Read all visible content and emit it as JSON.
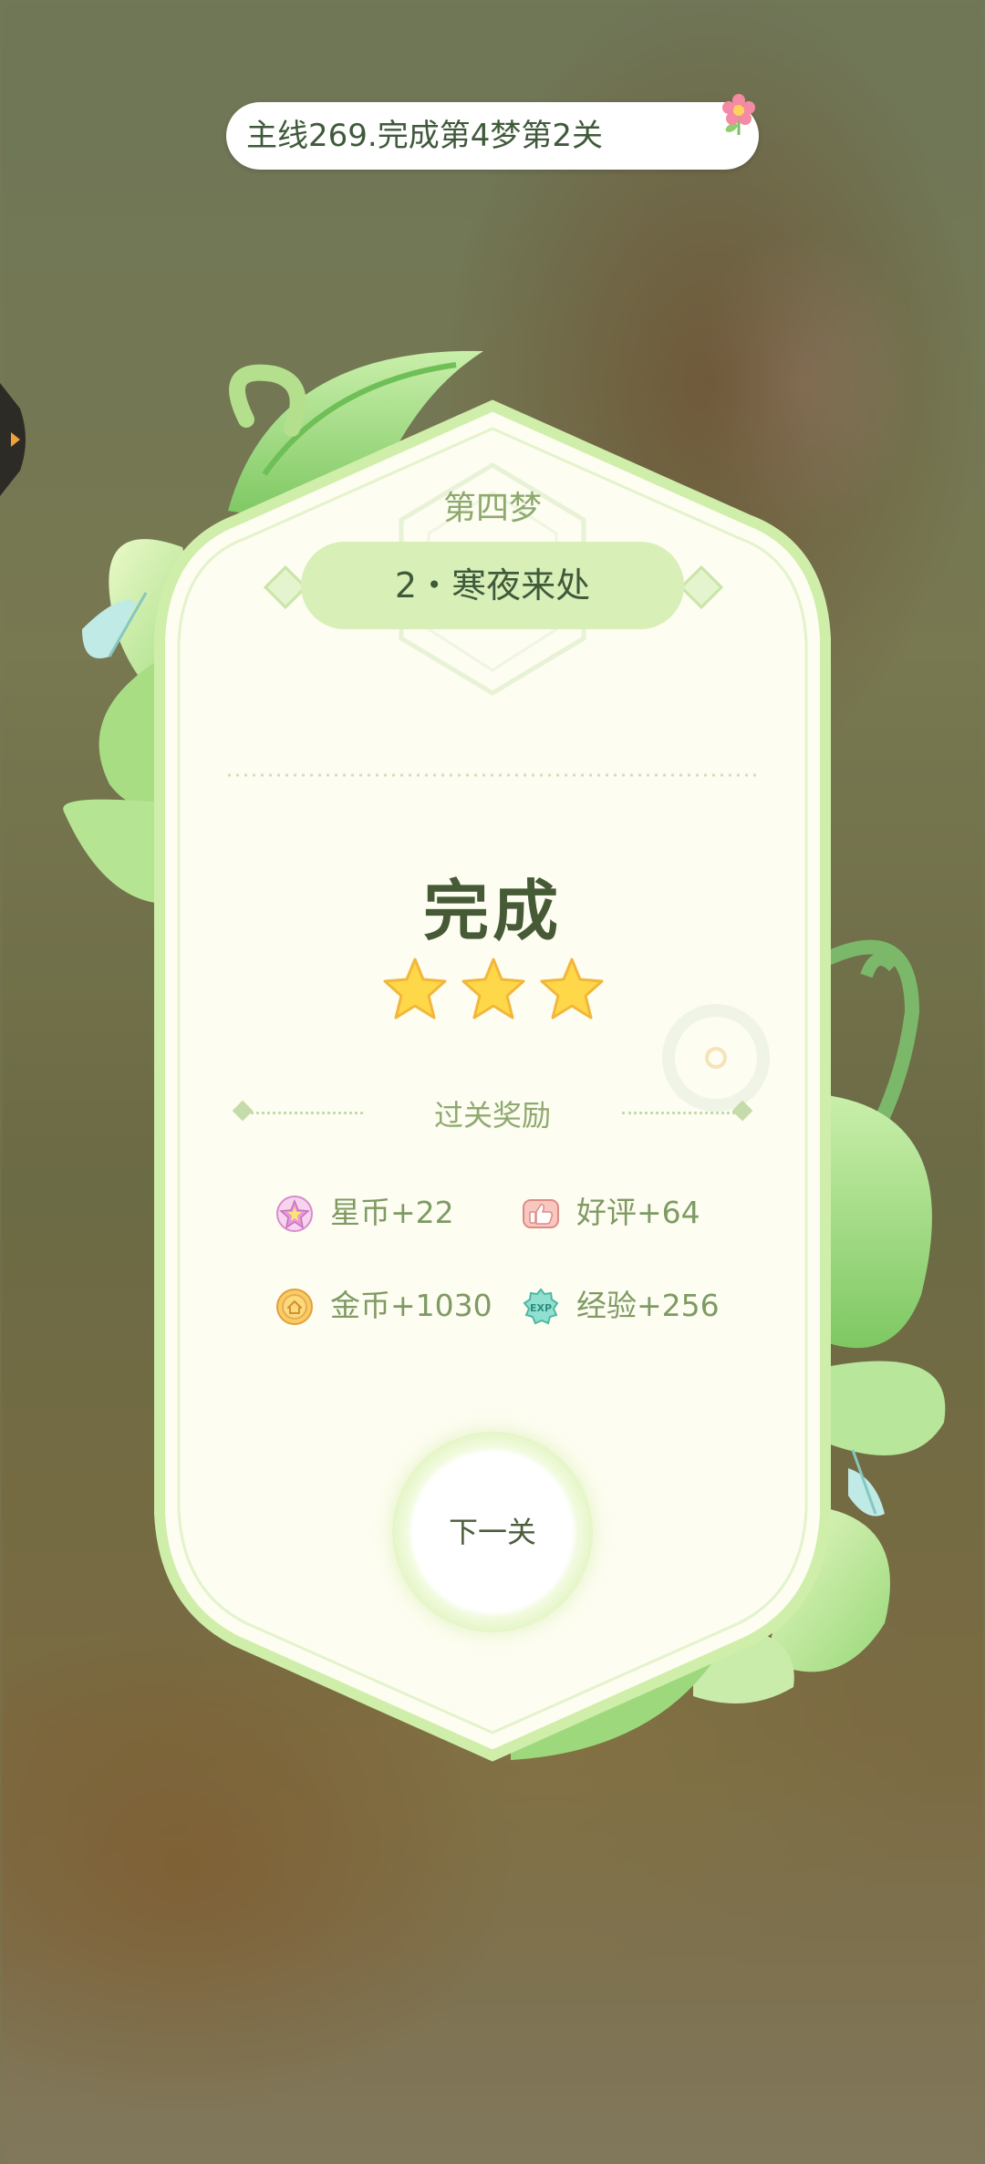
{
  "quest": {
    "text": "主线269.完成第4梦第2关"
  },
  "stage": {
    "dream": "第四梦",
    "level_name": "2・寒夜来处",
    "result": "完成",
    "stars_earned": 3,
    "stars_total": 3
  },
  "rewards": {
    "title": "过关奖励",
    "items": [
      {
        "label": "星币+22",
        "icon": "star-coin-icon"
      },
      {
        "label": "好评+64",
        "icon": "thumbs-up-icon"
      },
      {
        "label": "金币+1030",
        "icon": "gold-coin-icon"
      },
      {
        "label": "经验+256",
        "icon": "experience-icon"
      }
    ]
  },
  "next_button": {
    "label": "下一关"
  },
  "colors": {
    "accent_green": "#d8efb8",
    "text_dark_green": "#3f5a3a",
    "text_muted_green": "#8ea96e",
    "star_gold": "#ffd84a"
  }
}
